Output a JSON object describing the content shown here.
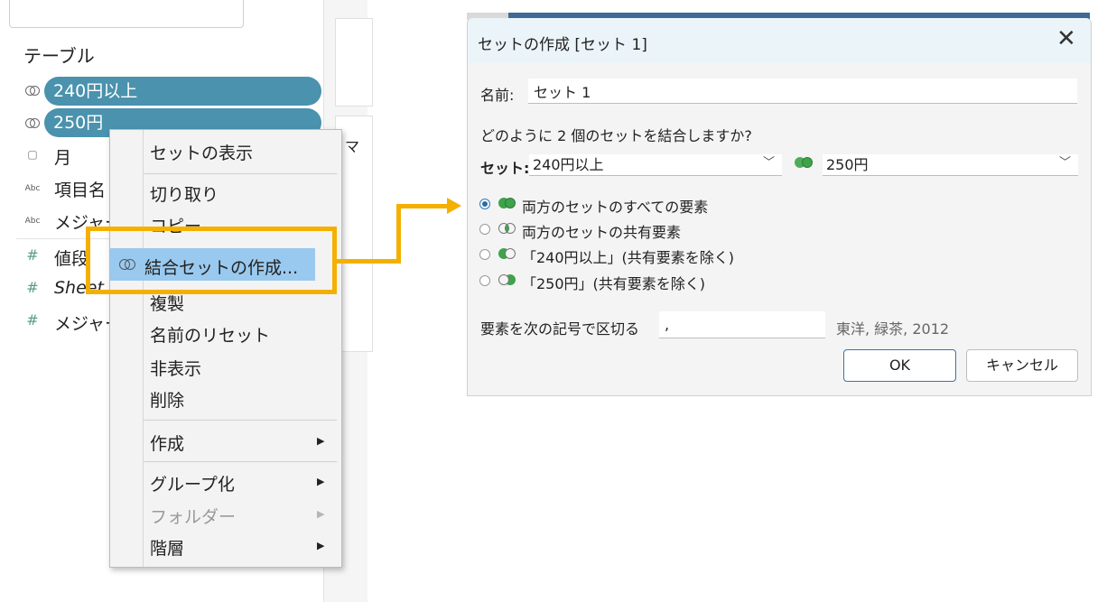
{
  "data_pane": {
    "tables_heading": "テーブル",
    "fields": [
      {
        "icon": "set-icon",
        "name": "240円以上",
        "kind": "set-pill"
      },
      {
        "icon": "set-icon",
        "name": "250円",
        "kind": "set-pill"
      },
      {
        "icon": "calendar-icon",
        "icon_glyph": "▢",
        "name": "月",
        "kind": "dimension"
      },
      {
        "icon": "abc-icon",
        "icon_glyph": "Abc",
        "name": "項目名",
        "kind": "dimension"
      },
      {
        "icon": "abc-icon",
        "icon_glyph": "Abc",
        "name": "メジャー",
        "kind": "dimension"
      },
      {
        "icon": "number-icon",
        "icon_glyph": "#",
        "name": "値段",
        "kind": "measure"
      },
      {
        "icon": "number-icon",
        "icon_glyph": "#",
        "name": "Sheet",
        "kind": "measure"
      },
      {
        "icon": "number-icon",
        "icon_glyph": "#",
        "name": "メジャー",
        "kind": "measure"
      }
    ],
    "mid_strip_label": "マ"
  },
  "context_menu": {
    "items": [
      {
        "label": "セットの表示",
        "enabled": true
      },
      {
        "label": "切り取り",
        "enabled": true
      },
      {
        "label": "コピー",
        "enabled": true
      },
      {
        "label": "結合セットの作成...",
        "enabled": true,
        "highlighted": true
      },
      {
        "label": "複製",
        "enabled": true
      },
      {
        "label": "名前のリセット",
        "enabled": true
      },
      {
        "label": "非表示",
        "enabled": true
      },
      {
        "label": "削除",
        "enabled": true
      },
      {
        "label": "作成",
        "enabled": true,
        "submenu": true
      },
      {
        "label": "グループ化",
        "enabled": true,
        "submenu": true
      },
      {
        "label": "フォルダー",
        "enabled": false,
        "submenu": true
      },
      {
        "label": "階層",
        "enabled": true,
        "submenu": true
      }
    ],
    "submenu_arrow": "▶"
  },
  "dialog": {
    "title": "セットの作成 [セット 1]",
    "close_glyph": "✕",
    "name_label": "名前:",
    "name_value": "セット 1",
    "question": "どのように 2 個のセットを結合しますか?",
    "sets_label": "セット:",
    "set_left": "240円以上",
    "set_right": "250円",
    "chevron": "﹀",
    "options": [
      {
        "label": "両方のセットのすべての要素",
        "selected": true,
        "venn": "union"
      },
      {
        "label": "両方のセットの共有要素",
        "selected": false,
        "venn": "intersection"
      },
      {
        "label": "「240円以上」(共有要素を除く)",
        "selected": false,
        "venn": "left-only"
      },
      {
        "label": "「250円」(共有要素を除く)",
        "selected": false,
        "venn": "right-only"
      }
    ],
    "separator_label": "要素を次の記号で区切る",
    "separator_value": ",",
    "separator_preview": "東洋, 緑茶, 2012",
    "ok_label": "OK",
    "cancel_label": "キャンセル"
  },
  "colors": {
    "pill": "#4a92ad",
    "highlight_frame": "#f3b000",
    "menu_highlight": "#99c9ef",
    "venn_green": "#3ea34a",
    "radio_blue": "#2b6aa8"
  }
}
